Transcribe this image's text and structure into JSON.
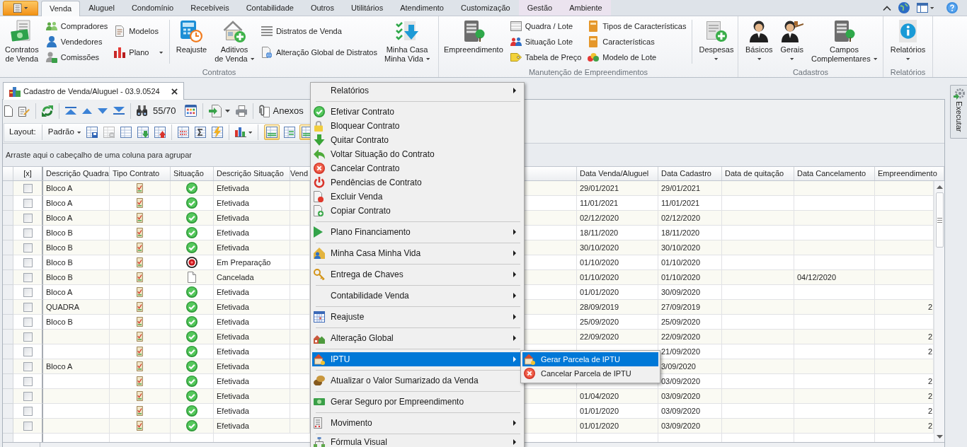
{
  "ribbon": {
    "tabs": [
      {
        "label": "Venda",
        "selected": true,
        "contextual": false
      },
      {
        "label": "Aluguel",
        "selected": false,
        "contextual": false
      },
      {
        "label": "Condomínio",
        "selected": false,
        "contextual": false
      },
      {
        "label": "Recebíveis",
        "selected": false,
        "contextual": false
      },
      {
        "label": "Contabilidade",
        "selected": false,
        "contextual": false
      },
      {
        "label": "Outros",
        "selected": false,
        "contextual": false
      },
      {
        "label": "Utilitários",
        "selected": false,
        "contextual": false
      },
      {
        "label": "Atendimento",
        "selected": false,
        "contextual": false
      },
      {
        "label": "Customização",
        "selected": false,
        "contextual": false
      },
      {
        "label": "Gestão",
        "selected": false,
        "contextual": true
      },
      {
        "label": "Ambiente",
        "selected": false,
        "contextual": true
      }
    ],
    "groups": [
      {
        "label": "Contratos",
        "sections": [
          {
            "kind": "large",
            "lines": [
              "Contratos",
              "de Venda"
            ],
            "dropdown": false
          },
          {
            "kind": "stack",
            "items": [
              {
                "label": "Compradores",
                "dropdown": false
              },
              {
                "label": "Vendedores",
                "dropdown": false
              },
              {
                "label": "Comissões",
                "dropdown": false
              }
            ]
          },
          {
            "kind": "stack",
            "items": [
              {
                "label": "Modelos",
                "dropdown": false
              },
              {
                "label": "Plano",
                "dropdown": true
              }
            ]
          },
          {
            "kind": "separator"
          },
          {
            "kind": "large",
            "lines": [
              "Reajuste"
            ],
            "dropdown": false
          },
          {
            "kind": "large",
            "lines": [
              "Aditivos",
              "de Venda"
            ],
            "dropdown": true
          },
          {
            "kind": "stack",
            "items": [
              {
                "label": "Distratos de Venda",
                "dropdown": false
              },
              {
                "label": "Alteração Global de Distratos",
                "dropdown": false
              }
            ]
          },
          {
            "kind": "large",
            "lines": [
              "Minha Casa",
              "Minha Vida"
            ],
            "dropdown": true
          }
        ]
      },
      {
        "label": "Manutenção de Empreendimentos",
        "sections": [
          {
            "kind": "large",
            "lines": [
              "Empreendimento"
            ],
            "dropdown": false
          },
          {
            "kind": "stack",
            "items": [
              {
                "label": "Quadra / Lote",
                "dropdown": false
              },
              {
                "label": "Situação Lote",
                "dropdown": false
              },
              {
                "label": "Tabela de Preço",
                "dropdown": false
              }
            ]
          },
          {
            "kind": "stack",
            "items": [
              {
                "label": "Tipos de Características",
                "dropdown": false
              },
              {
                "label": "Características",
                "dropdown": false
              },
              {
                "label": "Modelo de Lote",
                "dropdown": false
              }
            ]
          },
          {
            "kind": "separator"
          },
          {
            "kind": "large",
            "lines": [
              "Despesas"
            ],
            "dropdown": true
          }
        ]
      },
      {
        "label": "Cadastros",
        "sections": [
          {
            "kind": "large",
            "lines": [
              "Básicos"
            ],
            "dropdown": true
          },
          {
            "kind": "large",
            "lines": [
              "Gerais"
            ],
            "dropdown": true
          },
          {
            "kind": "large",
            "lines": [
              "Campos",
              "Complementares"
            ],
            "dropdown": true
          }
        ]
      },
      {
        "label": "Relatórios",
        "sections": [
          {
            "kind": "large",
            "lines": [
              "Relatórios"
            ],
            "dropdown": true
          }
        ]
      }
    ]
  },
  "document_tab": {
    "title": "Cadastro de Venda/Aluguel - 03.9.0524"
  },
  "toolbar": {
    "record_counter": "55/70",
    "attachments": "Anexos"
  },
  "layout_toolbar": {
    "label": "Layout:",
    "layout_name": "Padrão",
    "layout_buttons": [
      {
        "disabled": false
      },
      {
        "disabled": true
      },
      {
        "disabled": false
      },
      {
        "disabled": false
      },
      {
        "disabled": false
      }
    ],
    "view_toggles": [
      {
        "selected": true
      },
      {
        "selected": false
      },
      {
        "selected": true
      }
    ]
  },
  "group_panel": {
    "hint": "Arraste aqui o cabeçalho de uma coluna para agrupar"
  },
  "grid": {
    "columns": [
      {
        "label": "[x]"
      },
      {
        "label": "Descrição Quadra"
      },
      {
        "label": "Tipo Contrato"
      },
      {
        "label": "Situação"
      },
      {
        "label": "Descrição Situação"
      },
      {
        "label": "Vend"
      },
      {
        "label": "Data Venda/Aluguel"
      },
      {
        "label": "Data Cadastro"
      },
      {
        "label": "Data de quitação"
      },
      {
        "label": "Data Cancelamento"
      },
      {
        "label": "Empreendimento"
      }
    ],
    "rows": [
      {
        "checked": false,
        "quadra": "Bloco A",
        "status": {
          "kind": "effective",
          "label": "Efetivada"
        },
        "sale_date": "29/01/2021",
        "registration_date": "29/01/2021"
      },
      {
        "checked": false,
        "quadra": "Bloco A",
        "status": {
          "kind": "effective",
          "label": "Efetivada"
        },
        "sale_date": "11/01/2021",
        "registration_date": "11/01/2021"
      },
      {
        "checked": false,
        "quadra": "Bloco A",
        "status": {
          "kind": "effective",
          "label": "Efetivada"
        },
        "sale_date": "02/12/2020",
        "registration_date": "02/12/2020"
      },
      {
        "checked": false,
        "quadra": "Bloco B",
        "status": {
          "kind": "effective",
          "label": "Efetivada"
        },
        "sale_date": "18/11/2020",
        "registration_date": "18/11/2020"
      },
      {
        "checked": false,
        "quadra": "Bloco B",
        "status": {
          "kind": "effective",
          "label": "Efetivada"
        },
        "sale_date": "30/10/2020",
        "registration_date": "30/10/2020"
      },
      {
        "checked": false,
        "quadra": "Bloco B",
        "status": {
          "kind": "preparing",
          "label": "Em Preparação"
        },
        "sale_date": "01/10/2020",
        "registration_date": "01/10/2020"
      },
      {
        "checked": false,
        "quadra": "Bloco B",
        "status": {
          "kind": "cancelled",
          "label": "Cancelada"
        },
        "sale_date": "01/10/2020",
        "registration_date": "01/10/2020",
        "cancellation_date": "04/12/2020"
      },
      {
        "checked": false,
        "quadra": "Bloco A",
        "status": {
          "kind": "effective",
          "label": "Efetivada"
        },
        "sale_date": "01/01/2020",
        "registration_date": "30/09/2020"
      },
      {
        "checked": false,
        "quadra": "QUADRA",
        "status": {
          "kind": "effective",
          "label": "Efetivada"
        },
        "sale_date": "28/09/2019",
        "registration_date": "27/09/2019",
        "development": "2"
      },
      {
        "checked": false,
        "quadra": "Bloco B",
        "status": {
          "kind": "effective",
          "label": "Efetivada"
        },
        "sale_date": "25/09/2020",
        "registration_date": "25/09/2020"
      },
      {
        "checked": false,
        "status": {
          "kind": "effective",
          "label": "Efetivada"
        },
        "sale_date": "22/09/2020",
        "registration_date": "22/09/2020",
        "development": "2"
      },
      {
        "checked": false,
        "status": {
          "kind": "effective",
          "label": "Efetivada"
        },
        "registration_date": "21/09/2020",
        "development": "2"
      },
      {
        "checked": false,
        "quadra": "Bloco A",
        "status": {
          "kind": "effective",
          "label": "Efetivada"
        },
        "registration_date": "3/09/2020"
      },
      {
        "checked": false,
        "status": {
          "kind": "effective",
          "label": "Efetivada"
        },
        "registration_date": "03/09/2020",
        "development": "2"
      },
      {
        "checked": false,
        "status": {
          "kind": "effective",
          "label": "Efetivada"
        },
        "sale_date": "01/04/2020",
        "registration_date": "03/09/2020",
        "development": "2"
      },
      {
        "checked": false,
        "status": {
          "kind": "effective",
          "label": "Efetivada"
        },
        "sale_date": "01/01/2020",
        "registration_date": "03/09/2020",
        "development": "2"
      },
      {
        "checked": false,
        "status": {
          "kind": "effective",
          "label": "Efetivada"
        },
        "sale_date": "01/01/2020",
        "registration_date": "03/09/2020",
        "development": "2"
      }
    ]
  },
  "context_menu": {
    "items": [
      {
        "kind": "item",
        "label": "Relatórios",
        "submenu": true,
        "selected": false
      },
      {
        "kind": "separator"
      },
      {
        "kind": "item",
        "label": "Efetivar Contrato",
        "submenu": false,
        "selected": false
      },
      {
        "kind": "item",
        "label": "Bloquear Contrato",
        "submenu": false,
        "selected": false
      },
      {
        "kind": "item",
        "label": "Quitar Contrato",
        "submenu": false,
        "selected": false
      },
      {
        "kind": "item",
        "label": "Voltar Situação do Contrato",
        "submenu": false,
        "selected": false
      },
      {
        "kind": "item",
        "label": "Cancelar Contrato",
        "submenu": false,
        "selected": false
      },
      {
        "kind": "item",
        "label": "Pendências de Contrato",
        "submenu": false,
        "selected": false
      },
      {
        "kind": "item",
        "label": "Excluir Venda",
        "submenu": false,
        "selected": false
      },
      {
        "kind": "item",
        "label": "Copiar Contrato",
        "submenu": false,
        "selected": false
      },
      {
        "kind": "separator"
      },
      {
        "kind": "item",
        "label": "Plano Financiamento",
        "submenu": true,
        "selected": false
      },
      {
        "kind": "separator"
      },
      {
        "kind": "item",
        "label": "Minha Casa Minha Vida",
        "submenu": true,
        "selected": false
      },
      {
        "kind": "separator"
      },
      {
        "kind": "item",
        "label": "Entrega de Chaves",
        "submenu": true,
        "selected": false
      },
      {
        "kind": "separator"
      },
      {
        "kind": "item",
        "label": "Contabilidade Venda",
        "submenu": true,
        "selected": false
      },
      {
        "kind": "separator"
      },
      {
        "kind": "item",
        "label": "Reajuste",
        "submenu": true,
        "selected": false
      },
      {
        "kind": "separator"
      },
      {
        "kind": "item",
        "label": "Alteração Global",
        "submenu": true,
        "selected": false
      },
      {
        "kind": "separator"
      },
      {
        "kind": "item",
        "label": "IPTU",
        "submenu": true,
        "selected": true
      },
      {
        "kind": "separator"
      },
      {
        "kind": "item",
        "label": "Atualizar o Valor Sumarizado da Venda",
        "submenu": false,
        "selected": false
      },
      {
        "kind": "separator"
      },
      {
        "kind": "item",
        "label": "Gerar Seguro por Empreendimento",
        "submenu": false,
        "selected": false
      },
      {
        "kind": "separator"
      },
      {
        "kind": "item",
        "label": "Movimento",
        "submenu": true,
        "selected": false
      },
      {
        "kind": "separator"
      },
      {
        "kind": "item",
        "label": "Fórmula Visual",
        "submenu": true,
        "selected": false
      }
    ]
  },
  "submenu": {
    "items": [
      {
        "label": "Gerar Parcela de IPTU",
        "selected": true
      },
      {
        "label": "Cancelar Parcela de IPTU",
        "selected": false
      }
    ]
  },
  "side_panel": {
    "label": "Executar"
  }
}
